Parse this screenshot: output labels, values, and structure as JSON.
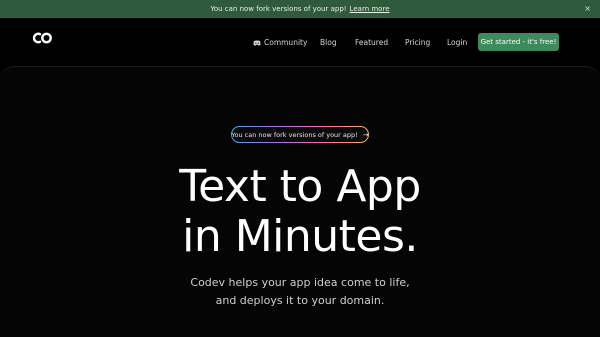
{
  "announcement": {
    "text": "You can now fork versions of your app!",
    "link_label": "Learn more",
    "close_label": "×"
  },
  "nav": {
    "links": [
      {
        "label": "Community"
      },
      {
        "label": "Blog"
      },
      {
        "label": "Featured"
      },
      {
        "label": "Pricing"
      },
      {
        "label": "Login"
      }
    ],
    "cta_label": "Get started - it's free!"
  },
  "hero": {
    "pill_text": "You can now fork versions of your app!",
    "pill_arrow": "→",
    "title_line1": "Text to App",
    "title_line2": "in Minutes.",
    "subtitle_line1": "Codev helps your app idea come to life,",
    "subtitle_line2": "and deploys it to your domain."
  },
  "colors": {
    "announcement_bg": "#2f5a3c",
    "cta_bg": "#3f8a5c",
    "page_bg": "#000000"
  },
  "icons": {
    "logo": "codev-logo-icon",
    "community": "discord-icon",
    "close": "close-icon",
    "pill_arrow": "arrow-right-icon"
  }
}
